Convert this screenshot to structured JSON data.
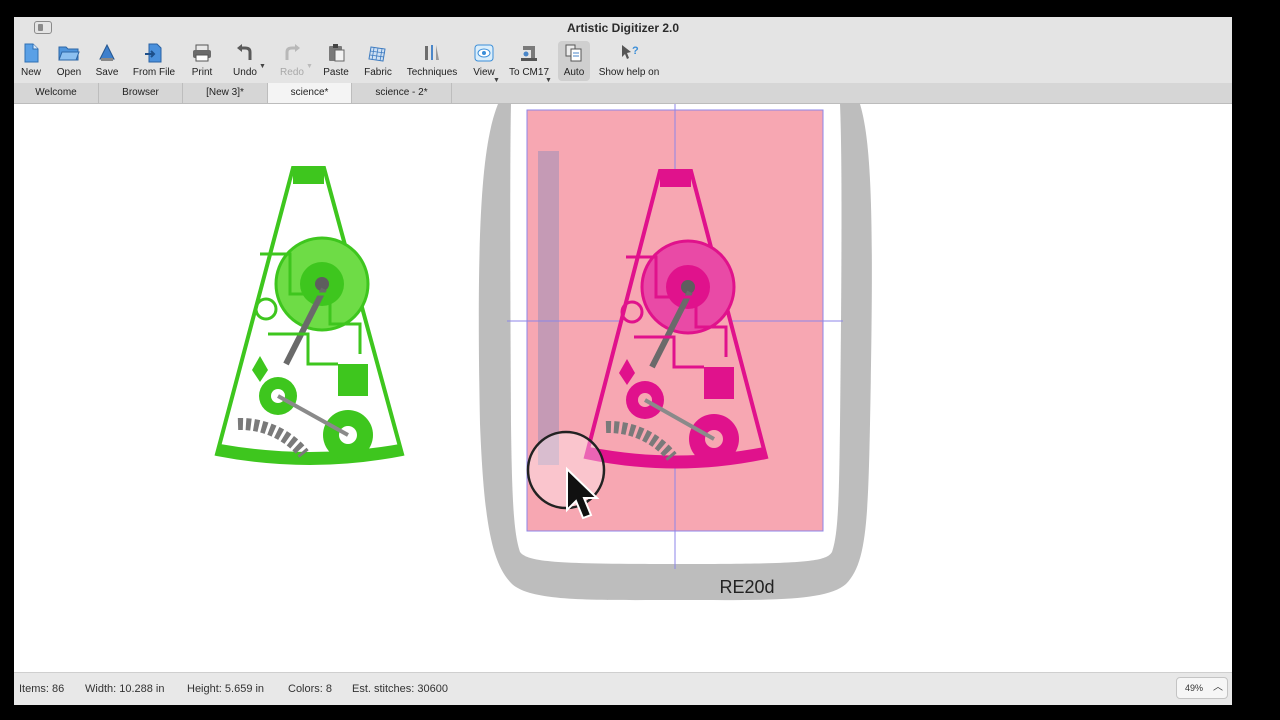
{
  "app": {
    "title": "Artistic Digitizer 2.0"
  },
  "toolbar": {
    "items": [
      {
        "label": "New",
        "icon": "new-document-icon"
      },
      {
        "label": "Open",
        "icon": "open-folder-icon"
      },
      {
        "label": "Save",
        "icon": "save-icon"
      },
      {
        "label": "From File",
        "icon": "import-file-icon"
      },
      {
        "label": "Print",
        "icon": "printer-icon"
      },
      {
        "label": "Undo",
        "icon": "undo-icon"
      },
      {
        "label": "Redo",
        "icon": "redo-icon",
        "disabled": true
      },
      {
        "label": "Paste",
        "icon": "paste-icon"
      },
      {
        "label": "Fabric",
        "icon": "fabric-icon"
      },
      {
        "label": "Techniques",
        "icon": "techniques-icon"
      },
      {
        "label": "View",
        "icon": "eye-icon"
      },
      {
        "label": "To CM17",
        "icon": "sewing-machine-icon"
      },
      {
        "label": "Auto",
        "icon": "auto-digitize-icon",
        "active": true
      },
      {
        "label": "Show help on",
        "icon": "help-cursor-icon"
      }
    ]
  },
  "tabs": [
    {
      "label": "Welcome",
      "active": false
    },
    {
      "label": "Browser",
      "active": false
    },
    {
      "label": "[New 3]*",
      "active": false
    },
    {
      "label": "science*",
      "active": true
    },
    {
      "label": "science - 2*",
      "active": false
    }
  ],
  "canvas": {
    "hoop_label": "RE20d",
    "left_design_color": "#3ec61e",
    "right_design_color": "#e0128c",
    "hoop_fill_color": "#f7a7b2",
    "hoop_frame_color": "#bdbdbd",
    "guide_color": "#8c86e8"
  },
  "status": {
    "items": "Items: 86",
    "width": "Width: 10.288 in",
    "height": "Height: 5.659 in",
    "colors": "Colors: 8",
    "stitches": "Est. stitches: 30600",
    "zoom": "49%"
  }
}
